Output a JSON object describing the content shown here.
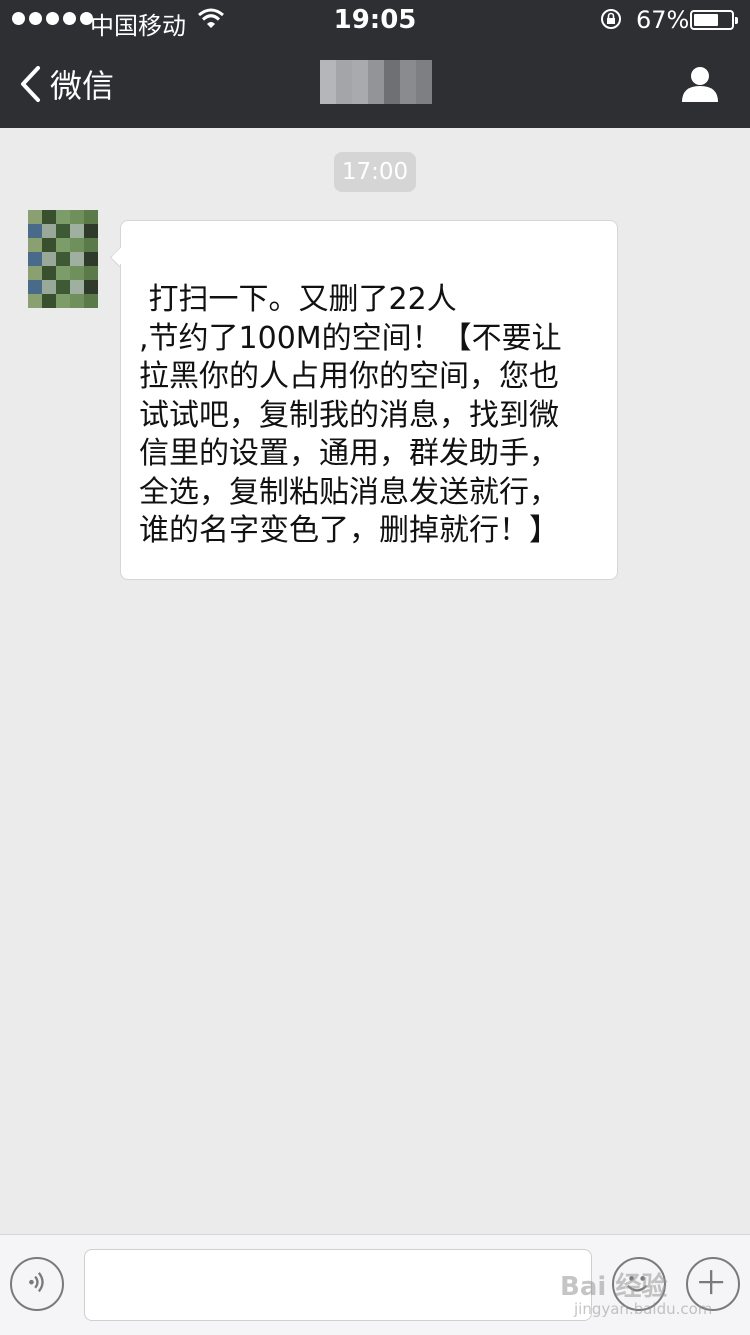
{
  "status_bar": {
    "carrier": "中国移动",
    "time": "19:05",
    "battery_percent": "67%",
    "battery_level": 0.67,
    "icons": [
      "signal-dots-icon",
      "wifi-icon",
      "rotation-lock-icon",
      "battery-icon"
    ]
  },
  "nav": {
    "back_label": "微信",
    "title_pixelated": true,
    "icons": [
      "back-chevron-icon",
      "contact-profile-icon"
    ]
  },
  "chat": {
    "timestamp": "17:00",
    "messages": [
      {
        "side": "left",
        "avatar_pixelated": true,
        "text": " 打扫一下。又删了22人\n,节约了100M的空间！【不要让\n拉黑你的人占用你的空间，您也\n试试吧，复制我的消息，找到微\n信里的设置，通用，群发助手，\n全选，复制粘贴消息发送就行，\n谁的名字变色了，删掉就行！】"
      }
    ]
  },
  "input_bar": {
    "input_value": "",
    "icons": [
      "voice-icon",
      "emoji-icon",
      "plus-icon"
    ]
  },
  "watermark": {
    "text": "Bai 经验",
    "sub": "jingyan.baidu.com"
  },
  "colors": {
    "nav_bg": "#2e2f33",
    "chat_bg": "#ebebeb",
    "bubble_bg": "#ffffff",
    "timestamp_bg": "#d5d5d5"
  }
}
